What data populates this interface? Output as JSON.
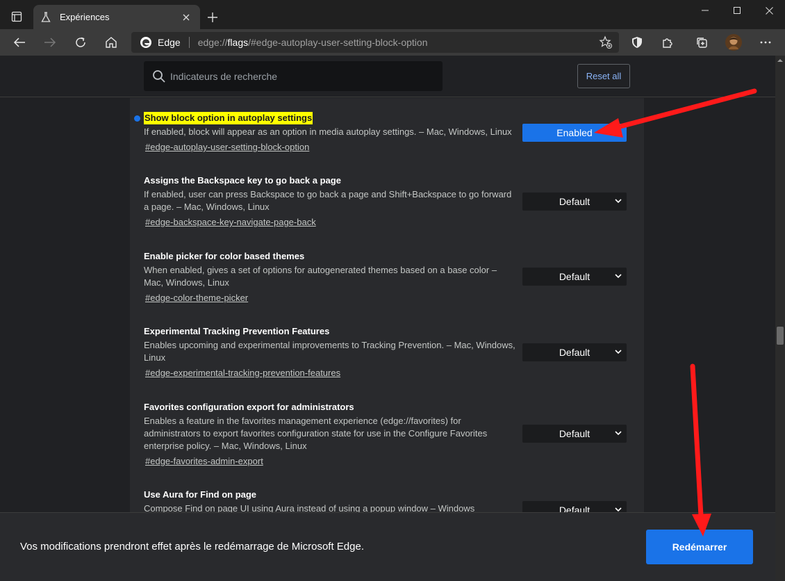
{
  "window": {
    "tab_title": "Expériences",
    "new_tab_symbol": "+"
  },
  "toolbar": {
    "site_name": "Edge",
    "url_scheme": "edge://",
    "url_host": "flags",
    "url_path": "/#edge-autoplay-user-setting-block-option"
  },
  "search": {
    "placeholder": "Indicateurs de recherche"
  },
  "reset_all_label": "Reset all",
  "flags": [
    {
      "title": "Show block option in autoplay settings",
      "highlighted": true,
      "modified": true,
      "description": "If enabled, block will appear as an option in media autoplay settings. – Mac, Windows, Linux",
      "link": "#edge-autoplay-user-setting-block-option",
      "value": "Enabled"
    },
    {
      "title": "Assigns the Backspace key to go back a page",
      "description": "If enabled, user can press Backspace to go back a page and Shift+Backspace to go forward a page. – Mac, Windows, Linux",
      "link": "#edge-backspace-key-navigate-page-back",
      "value": "Default"
    },
    {
      "title": "Enable picker for color based themes",
      "description": "When enabled, gives a set of options for autogenerated themes based on a base color – Mac, Windows, Linux",
      "link": "#edge-color-theme-picker",
      "value": "Default"
    },
    {
      "title": "Experimental Tracking Prevention Features",
      "description": "Enables upcoming and experimental improvements to Tracking Prevention. – Mac, Windows, Linux",
      "link": "#edge-experimental-tracking-prevention-features",
      "value": "Default"
    },
    {
      "title": "Favorites configuration export for administrators",
      "description": "Enables a feature in the favorites management experience (edge://favorites) for administrators to export favorites configuration state for use in the Configure Favorites enterprise policy. – Mac, Windows, Linux",
      "link": "#edge-favorites-admin-export",
      "value": "Default"
    },
    {
      "title": "Use Aura for Find on page",
      "description": "Compose Find on page UI using Aura instead of using a popup window – Windows",
      "link": "",
      "value": "Default"
    }
  ],
  "restart": {
    "message": "Vos modifications prendront effet après le redémarrage de Microsoft Edge.",
    "button_label": "Redémarrer"
  },
  "colors": {
    "accent": "#1a73e8",
    "highlight": "#ffff00",
    "annotation_arrow": "#ff1a1a"
  },
  "icons": [
    "tab-actions-icon",
    "flask-icon",
    "close-icon",
    "back-icon",
    "forward-icon",
    "refresh-icon",
    "home-icon",
    "edge-logo-icon",
    "favorite-add-icon",
    "shield-extension-icon",
    "puzzle-extension-icon",
    "collections-icon",
    "profile-avatar",
    "more-icon",
    "search-icon",
    "chevron-down-icon"
  ]
}
